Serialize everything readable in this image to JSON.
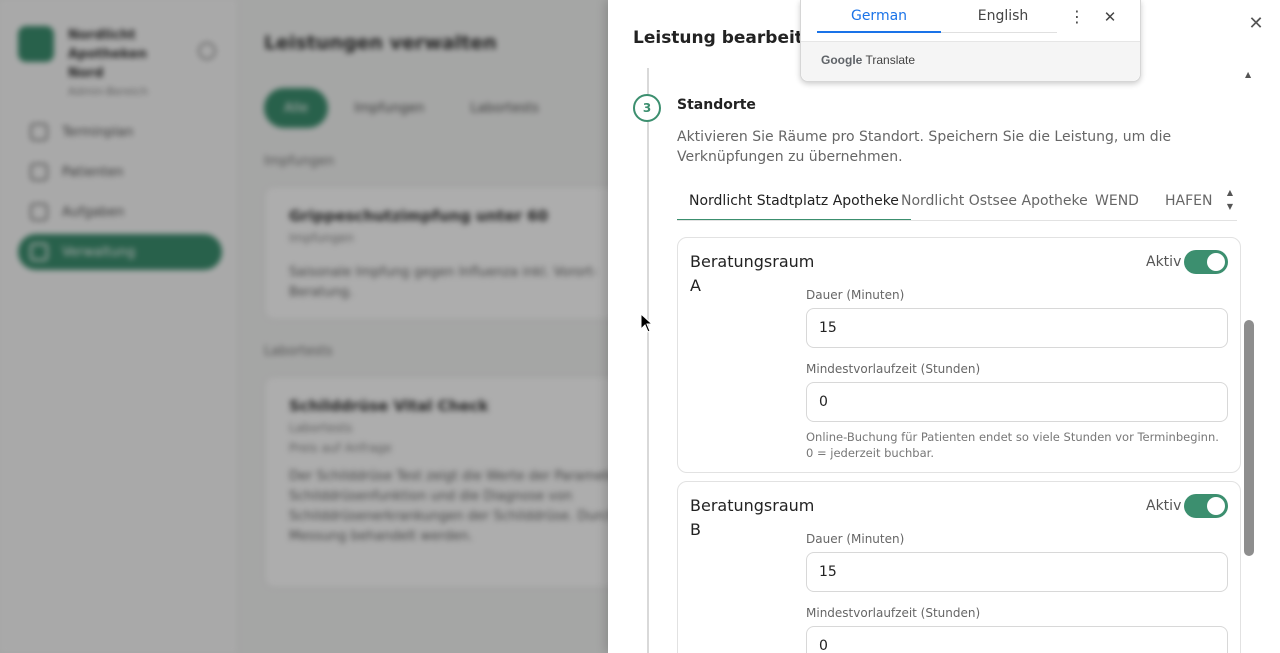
{
  "background": {
    "brand": {
      "name": "Nordlicht Apotheken Nord",
      "subtitle": "Admin-Bereich"
    },
    "nav": [
      {
        "label": "Terminplan",
        "active": false
      },
      {
        "label": "Patienten",
        "active": false
      },
      {
        "label": "Aufgaben",
        "active": false
      },
      {
        "label": "Verwaltung",
        "active": true
      }
    ],
    "page_title": "Leistungen verwalten",
    "filters": [
      {
        "label": "Alle",
        "active": true
      },
      {
        "label": "Impfungen",
        "active": false
      },
      {
        "label": "Labortests",
        "active": false
      }
    ],
    "sections": [
      {
        "heading": "Impfungen",
        "card": {
          "title": "Grippeschutzimpfung unter 60",
          "category": "Impfungen",
          "text": "Saisonale Impfung gegen Influenza inkl. Vorort-Beratung."
        }
      },
      {
        "heading": "Labortests",
        "card": {
          "title": "Schilddrüse Vital Check",
          "category": "Labortests",
          "price": "Preis auf Anfrage",
          "text": "Der Schilddrüse Test zeigt die Werte der Parameter der Schilddrüsenfunktion und die Diagnose von Schilddrüsenerkrankungen der Schilddrüse. Durch die Messung behandelt werden."
        }
      }
    ]
  },
  "drawer": {
    "title": "Leistung bearbeiten",
    "close_icon": "close-icon",
    "step": {
      "number": "3",
      "title": "Standorte",
      "description": "Aktivieren Sie Räume pro Standort. Speichern Sie die Leistung, um die Verknüpfungen zu übernehmen."
    },
    "tabs": [
      {
        "label": "Nordlicht Stadtplatz Apotheke",
        "active": true
      },
      {
        "label": "Nordlicht Ostsee Apotheke",
        "active": false
      },
      {
        "label": "WEND",
        "active": false
      },
      {
        "label": "HAFEN",
        "active": false
      }
    ],
    "rooms": [
      {
        "name": "Beratungsraum A",
        "active_label": "Aktiv",
        "active": true,
        "duration_label": "Dauer (Minuten)",
        "duration_value": "15",
        "lead_label": "Mindestvorlaufzeit (Stunden)",
        "lead_value": "0",
        "help": "Online-Buchung für Patienten endet so viele Stunden vor Terminbeginn. 0 = jederzeit buchbar."
      },
      {
        "name": "Beratungsraum B",
        "active_label": "Aktiv",
        "active": true,
        "duration_label": "Dauer (Minuten)",
        "duration_value": "15",
        "lead_label": "Mindestvorlaufzeit (Stunden)",
        "lead_value": "0"
      }
    ]
  },
  "translate_popup": {
    "tabs": [
      {
        "label": "German",
        "active": true
      },
      {
        "label": "English",
        "active": false
      }
    ],
    "brand_google": "Google",
    "brand_translate": "Translate",
    "accent": "#1a73e8"
  },
  "colors": {
    "accent": "#3c8f6f"
  }
}
